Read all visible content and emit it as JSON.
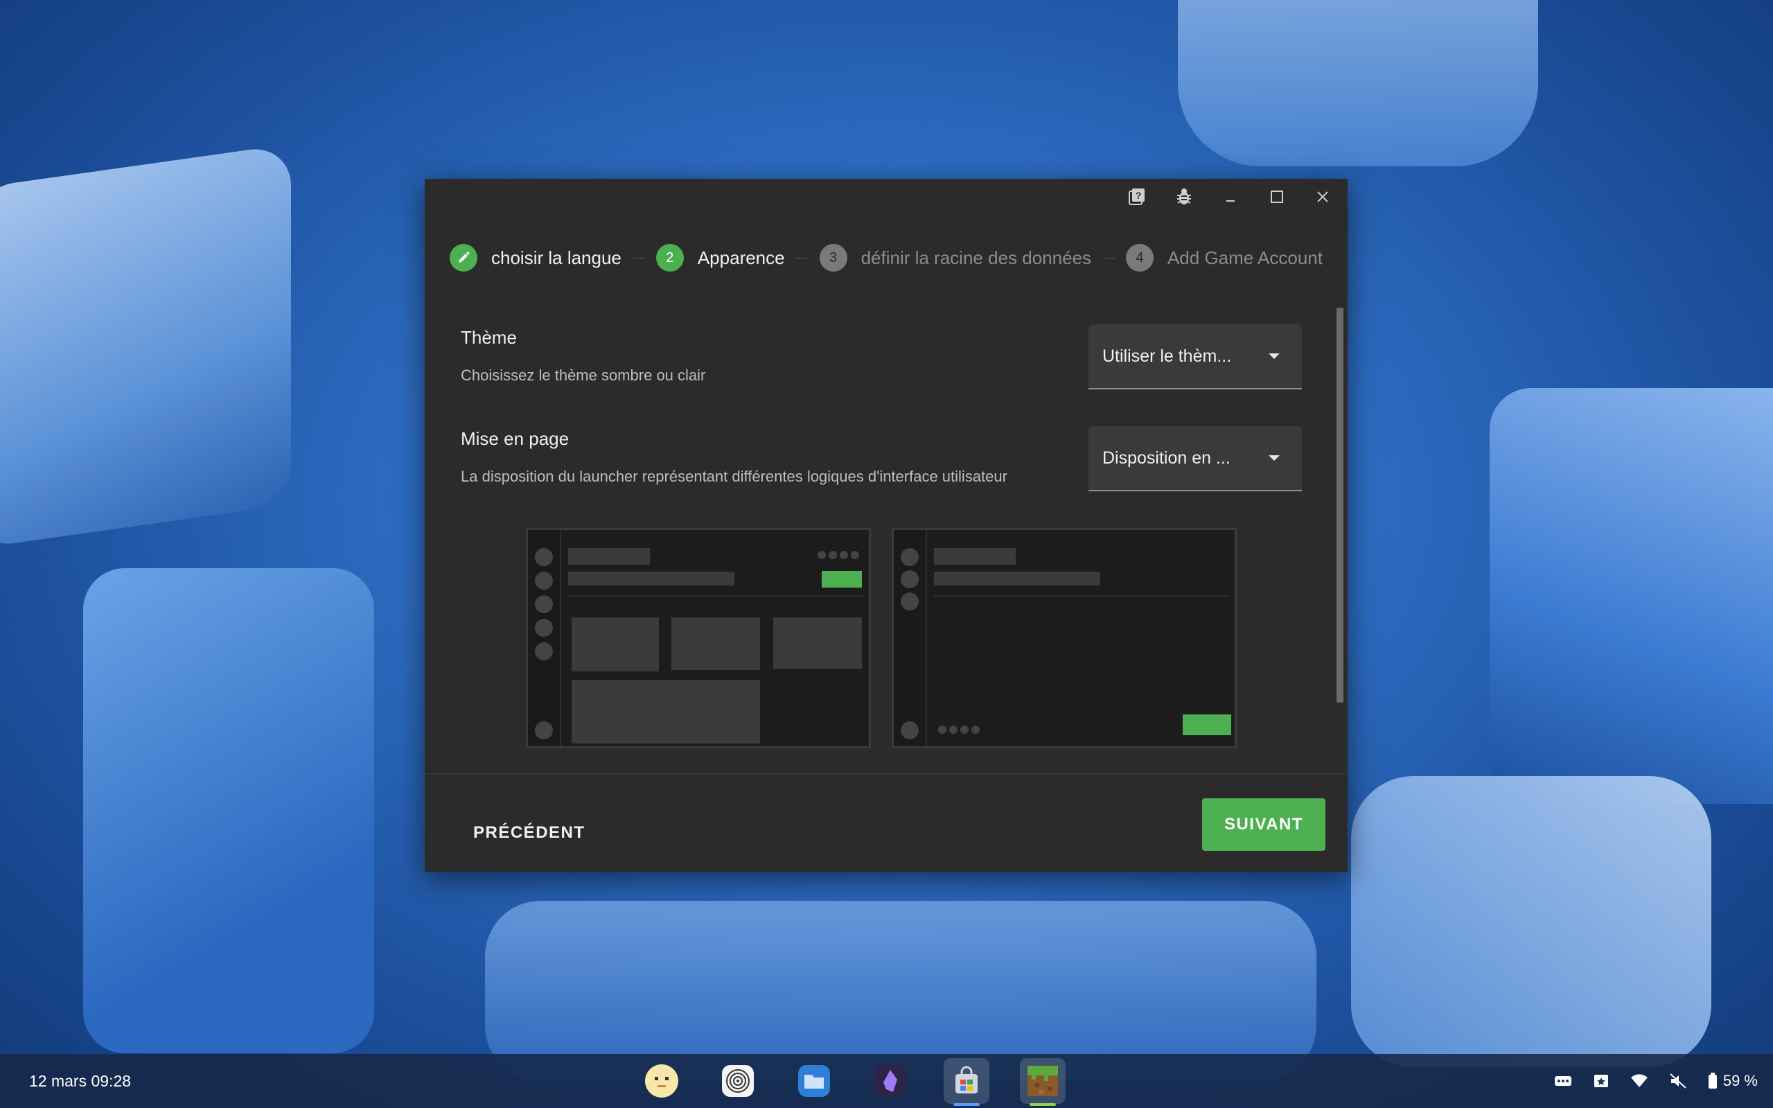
{
  "stepper": {
    "steps": [
      {
        "number": "",
        "label": "choisir la langue",
        "state": "done"
      },
      {
        "number": "2",
        "label": "Apparence",
        "state": "active"
      },
      {
        "number": "3",
        "label": "définir la racine des données",
        "state": "pending"
      },
      {
        "number": "4",
        "label": "Add Game Account",
        "state": "pending"
      }
    ]
  },
  "settings": {
    "theme": {
      "title": "Thème",
      "description": "Choisissez le thème sombre ou clair",
      "value": "Utiliser le thèm..."
    },
    "layout": {
      "title": "Mise en page",
      "description": "La disposition du launcher représentant différentes logiques d'interface utilisateur",
      "value": "Disposition en ..."
    }
  },
  "footer": {
    "prev_label": "PRÉCÉDENT",
    "next_label": "SUIVANT"
  },
  "shelf": {
    "datetime": "12 mars  09:28",
    "apps": [
      "pixel-face-app",
      "spiral-app",
      "files-app",
      "obsidian-app",
      "store-app",
      "minecraft-launcher-app"
    ],
    "battery": "59 %"
  },
  "colors": {
    "accent": "#4caf50",
    "window_bg": "#2b2b2b"
  }
}
